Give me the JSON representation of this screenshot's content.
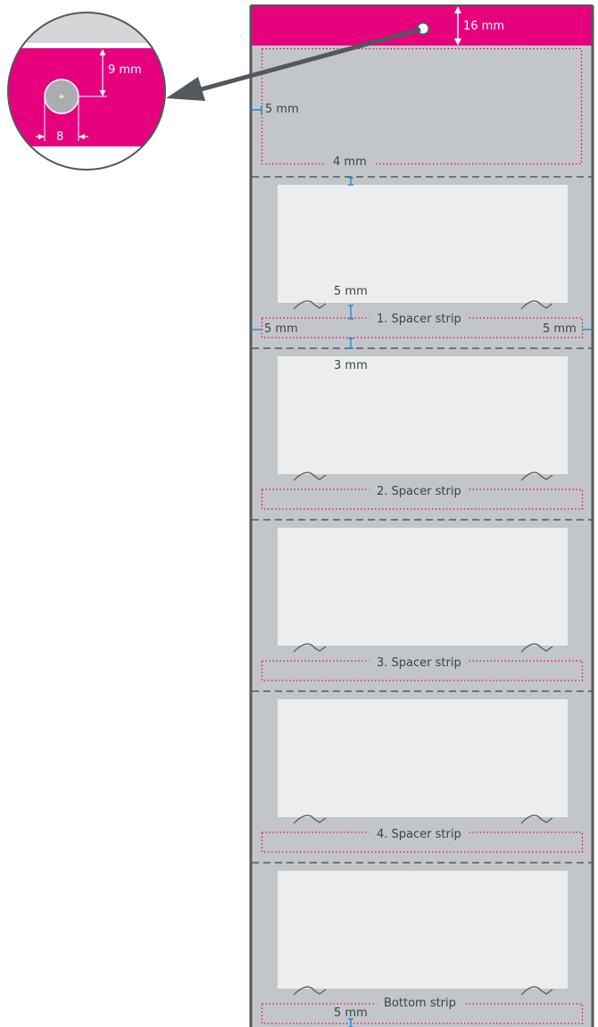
{
  "colors": {
    "magenta": "#e6007e",
    "strip_grey": "#c3c6c8",
    "label_white": "#ebedee",
    "outline": "#53585c",
    "dimension_blue": "#1a8cd8",
    "text": "#3d4347"
  },
  "header": {
    "dimension": "16 mm",
    "hang_hole_icon": "circle-hole-icon"
  },
  "detail": {
    "hole_offset": "9 mm",
    "hole_diameter": "8",
    "arrow_icon": "pointer-arrow-icon"
  },
  "margins": {
    "top_side": "5 mm",
    "top_bottom": "4 mm",
    "label_gap_top": "5 mm",
    "side_left": "5 mm",
    "side_right": "5 mm",
    "label_gap": "3 mm",
    "bottom": "5 mm"
  },
  "strips": [
    {
      "label": "1. Spacer strip"
    },
    {
      "label": "2. Spacer strip"
    },
    {
      "label": "3. Spacer strip"
    },
    {
      "label": "4. Spacer strip"
    },
    {
      "label": "Bottom strip"
    }
  ]
}
